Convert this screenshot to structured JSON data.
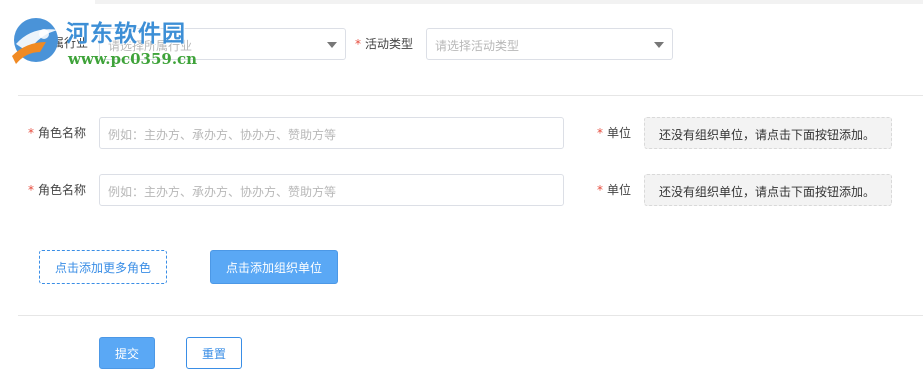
{
  "watermark": {
    "title": "河东软件园",
    "url": "www.pc0359.cn"
  },
  "filters": {
    "industry": {
      "label": "所属行业",
      "placeholder": "请选择所属行业"
    },
    "activity_type": {
      "label": "活动类型",
      "placeholder": "请选择活动类型"
    },
    "required_mark": "*"
  },
  "roles": [
    {
      "label": "角色名称",
      "placeholder": "例如：主办方、承办方、协办方、赞助方等",
      "unit_label": "单位",
      "unit_empty_text": "还没有组织单位，请点击下面按钮添加。"
    },
    {
      "label": "角色名称",
      "placeholder": "例如：主办方、承办方、协办方、赞助方等",
      "unit_label": "单位",
      "unit_empty_text": "还没有组织单位，请点击下面按钮添加。"
    }
  ],
  "actions": {
    "add_role": "点击添加更多角色",
    "add_unit": "点击添加组织单位",
    "submit": "提交",
    "reset": "重置"
  },
  "colors": {
    "accent": "#3a8ee6",
    "primary_button": "#5aa8f5",
    "required": "#e64b3c",
    "watermark_title": "#3d8fd6",
    "watermark_url": "#3fa33a"
  }
}
